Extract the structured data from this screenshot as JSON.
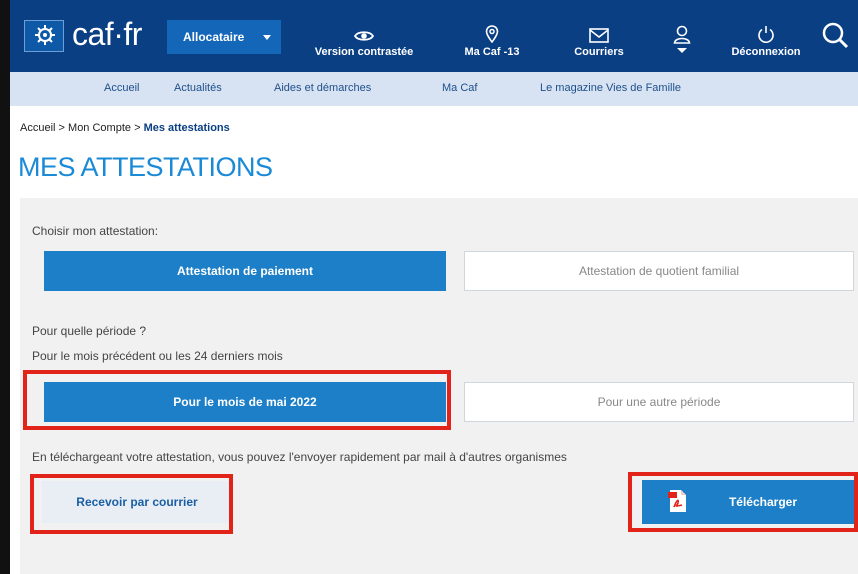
{
  "header": {
    "logo_text": "caf·fr",
    "role_select": "Allocataire",
    "nav": [
      {
        "icon": "eye-icon",
        "label": "Version contrastée"
      },
      {
        "icon": "map-pin-icon",
        "label": "Ma Caf -13"
      },
      {
        "icon": "mail-icon",
        "label": "Courriers"
      },
      {
        "icon": "user-icon",
        "label": ""
      },
      {
        "icon": "power-icon",
        "label": "Déconnexion"
      }
    ],
    "search_icon": "search-icon"
  },
  "subnav": [
    "Accueil",
    "Actualités",
    "Aides et démarches",
    "Ma Caf",
    "Le magazine Vies de Famille"
  ],
  "breadcrumb": {
    "home": "Accueil",
    "sep1": ">",
    "parent": "Mon Compte",
    "sep2": ">",
    "current": "Mes attestations"
  },
  "page_title": "MES ATTESTATIONS",
  "form": {
    "choose_label": "Choisir mon attestation:",
    "type_options": [
      "Attestation de paiement",
      "Attestation de quotient familial"
    ],
    "period_question": "Pour quelle période ?",
    "period_hint": "Pour le mois précédent ou les 24 derniers mois",
    "period_options": [
      "Pour le mois de mai 2022",
      "Pour une autre période"
    ],
    "info_text": "En téléchargeant votre attestation, vous pouvez l'envoyer rapidement par mail à d'autres organismes",
    "mail_button": "Recevoir par courrier",
    "download_button": "Télécharger"
  },
  "colors": {
    "header_bg": "#0a3f83",
    "accent": "#1d7fc7",
    "highlight": "#e2231a"
  }
}
